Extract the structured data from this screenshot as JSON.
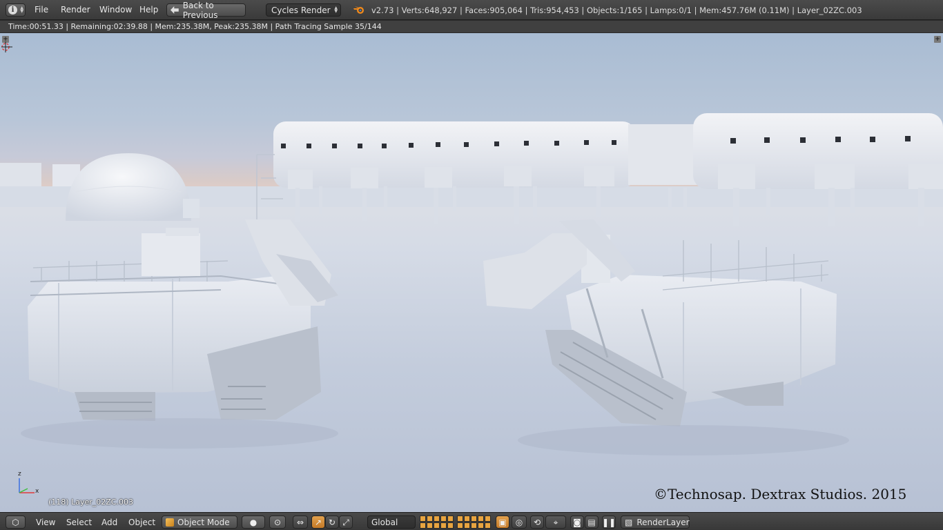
{
  "header": {
    "editor_type_icon": "info-icon",
    "menus": [
      "File",
      "Render",
      "Window",
      "Help"
    ],
    "back_button": "Back to Previous",
    "render_engine": "Cycles Render",
    "logo_icon": "blender-logo-icon",
    "stats": "v2.73 | Verts:648,927 | Faces:905,064 | Tris:954,453 | Objects:1/165 | Lamps:0/1 | Mem:457.76M (0.11M) | Layer_02ZC.003"
  },
  "render_status": "Time:00:51.33 | Remaining:02:39.88 | Mem:235.38M, Peak:235.38M | Path Tracing Sample 35/144",
  "viewport": {
    "object_info": "(118) Layer_02ZC.003",
    "copyright": "©Technosap. Dextrax Studios. 2015",
    "gizmo_axes": {
      "z": "z",
      "x": "x"
    }
  },
  "footer": {
    "menus": [
      "View",
      "Select",
      "Add",
      "Object"
    ],
    "mode": "Object Mode",
    "orientation": "Global",
    "render_layer": "RenderLayer",
    "icons": [
      "viewport-shading-icon",
      "pivot-icon",
      "manipulator-icon",
      "translate-icon",
      "rotate-icon",
      "scale-icon",
      "lock-layer-icon",
      "proportional-edit-icon",
      "snap-icon",
      "render-still-icon",
      "render-animation-icon",
      "pause-icon",
      "render-layer-icon"
    ]
  },
  "colors": {
    "accent": "#e8a440",
    "header_bg": "#404040",
    "sky_top": "#a9bcd3",
    "snow": "#d5dbe6"
  }
}
